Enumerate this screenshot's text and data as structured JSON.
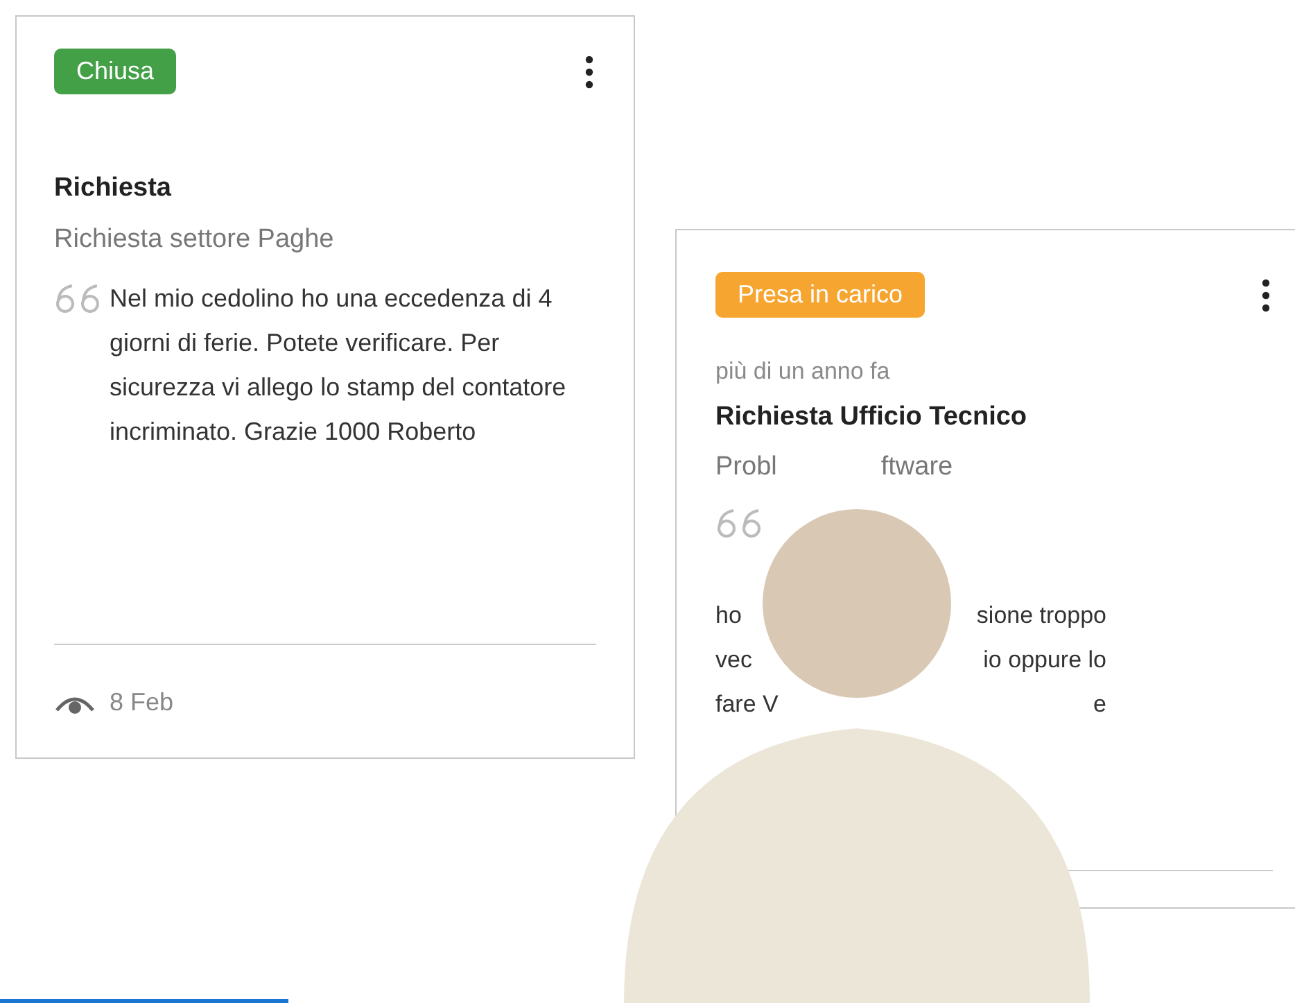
{
  "cards": [
    {
      "status": {
        "label": "Chiusa",
        "color": "#43a047"
      },
      "title": "Richiesta",
      "subtitle": [
        "Richiesta settore Paghe"
      ],
      "body": [
        [
          "Nel mio cedolino ho una eccedenza di 4 giorni di ferie. Potete verificare. Per sicurezza vi allego lo stamp del contatore incriminato. Grazie 1000 Roberto"
        ]
      ],
      "date": "8 Feb"
    },
    {
      "status": {
        "label": "Presa in carico",
        "color": "#f7a531"
      },
      "time": "più di un anno fa",
      "title": "Richiesta Ufficio Tecnico",
      "subtitle": [
        "Probl",
        "ftware"
      ],
      "body": [
        [
          "ho",
          "sione troppo"
        ],
        [
          "vec",
          "io oppure lo"
        ],
        [
          "fare V",
          "e"
        ]
      ]
    }
  ]
}
